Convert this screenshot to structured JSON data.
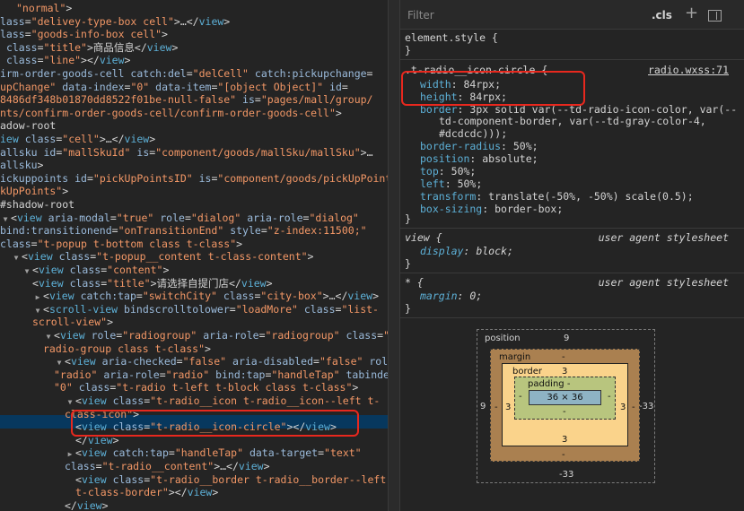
{
  "dom_lines": [
    {
      "segs": [
        [
          "v",
          "\"normal\""
        ],
        [
          "x",
          ">"
        ]
      ]
    },
    {
      "segs": [
        [
          "a",
          "lass"
        ],
        [
          "x",
          "="
        ],
        [
          "v",
          "\"delivey-type-box cell\""
        ],
        [
          "x",
          ">…</"
        ],
        [
          "t",
          "view"
        ],
        [
          "x",
          ">"
        ]
      ]
    },
    {
      "segs": [
        [
          "a",
          "lass"
        ],
        [
          "x",
          "="
        ],
        [
          "v",
          "\"goods-info-box cell\""
        ],
        [
          "x",
          ">"
        ]
      ]
    },
    {
      "segs": [
        [
          "x",
          " "
        ],
        [
          "a",
          "class"
        ],
        [
          "x",
          "="
        ],
        [
          "v",
          "\"title\""
        ],
        [
          "x",
          ">商品信息</"
        ],
        [
          "t",
          "view"
        ],
        [
          "x",
          ">"
        ]
      ]
    },
    {
      "segs": [
        [
          "x",
          " "
        ],
        [
          "a",
          "class"
        ],
        [
          "x",
          "="
        ],
        [
          "v",
          "\"line\""
        ],
        [
          "x",
          "></"
        ],
        [
          "t",
          "view"
        ],
        [
          "x",
          ">"
        ]
      ]
    },
    {
      "segs": [
        [
          "a",
          "irm-order-goods-cell"
        ],
        [
          "x",
          " "
        ],
        [
          "a",
          "catch:del"
        ],
        [
          "x",
          "="
        ],
        [
          "v",
          "\"delCell\""
        ],
        [
          "x",
          " "
        ],
        [
          "a",
          "catch:pickupchange"
        ],
        [
          "x",
          "="
        ]
      ]
    },
    {
      "segs": [
        [
          "v",
          "upChange\""
        ],
        [
          "x",
          " "
        ],
        [
          "a",
          "data-index"
        ],
        [
          "x",
          "="
        ],
        [
          "v",
          "\"0\""
        ],
        [
          "x",
          " "
        ],
        [
          "a",
          "data-item"
        ],
        [
          "x",
          "="
        ],
        [
          "v",
          "\"[object Object]\""
        ],
        [
          "x",
          " "
        ],
        [
          "a",
          "id"
        ],
        [
          "x",
          "="
        ]
      ]
    },
    {
      "segs": [
        [
          "v",
          "8486df348b01870dd8522f01be-null-false\""
        ],
        [
          "x",
          " "
        ],
        [
          "a",
          "is"
        ],
        [
          "x",
          "="
        ],
        [
          "v",
          "\"pages/mall/group/"
        ]
      ]
    },
    {
      "segs": [
        [
          "v",
          "nts/confirm-order-goods-cell/confirm-order-goods-cell\""
        ],
        [
          "x",
          ">"
        ]
      ]
    },
    {
      "segs": [
        [
          "x",
          "adow-root"
        ]
      ]
    },
    {
      "segs": [
        [
          "t",
          "iew"
        ],
        [
          "x",
          " "
        ],
        [
          "a",
          "class"
        ],
        [
          "x",
          "="
        ],
        [
          "v",
          "\"cell\""
        ],
        [
          "x",
          ">…</"
        ],
        [
          "t",
          "view"
        ],
        [
          "x",
          ">"
        ]
      ]
    },
    {
      "segs": [
        [
          "a",
          "allsku"
        ],
        [
          "x",
          " "
        ],
        [
          "a",
          "id"
        ],
        [
          "x",
          "="
        ],
        [
          "v",
          "\"mallSkuId\""
        ],
        [
          "x",
          " "
        ],
        [
          "a",
          "is"
        ],
        [
          "x",
          "="
        ],
        [
          "v",
          "\"component/goods/mallSku/mallSku\""
        ],
        [
          "x",
          ">…"
        ]
      ]
    },
    {
      "segs": [
        [
          "a",
          "allsku"
        ],
        [
          "x",
          ">"
        ]
      ]
    },
    {
      "segs": [
        [
          "a",
          "ickuppoints"
        ],
        [
          "x",
          " "
        ],
        [
          "a",
          "id"
        ],
        [
          "x",
          "="
        ],
        [
          "v",
          "\"pickUpPointsID\""
        ],
        [
          "x",
          " "
        ],
        [
          "a",
          "is"
        ],
        [
          "x",
          "="
        ],
        [
          "v",
          "\"component/goods/pickUpPoints/"
        ]
      ]
    },
    {
      "segs": [
        [
          "v",
          "kUpPoints\""
        ],
        [
          "x",
          ">"
        ]
      ]
    },
    {
      "segs": [
        [
          "x",
          "#shadow-root"
        ]
      ]
    },
    {
      "segs": [
        [
          "tri",
          "▼"
        ],
        [
          "x",
          "<"
        ],
        [
          "t",
          "view"
        ],
        [
          "x",
          " "
        ],
        [
          "a",
          "aria-modal"
        ],
        [
          "x",
          "="
        ],
        [
          "v",
          "\"true\""
        ],
        [
          "x",
          " "
        ],
        [
          "a",
          "role"
        ],
        [
          "x",
          "="
        ],
        [
          "v",
          "\"dialog\""
        ],
        [
          "x",
          " "
        ],
        [
          "a",
          "aria-role"
        ],
        [
          "x",
          "="
        ],
        [
          "v",
          "\"dialog\""
        ]
      ]
    },
    {
      "segs": [
        [
          "a",
          "bind:transitionend"
        ],
        [
          "x",
          "="
        ],
        [
          "v",
          "\"onTransitionEnd\""
        ],
        [
          "x",
          " "
        ],
        [
          "a",
          "style"
        ],
        [
          "x",
          "="
        ],
        [
          "v",
          "\"z-index:11500;\""
        ]
      ]
    },
    {
      "segs": [
        [
          "a",
          "class"
        ],
        [
          "x",
          "="
        ],
        [
          "v",
          "\"t-popup t-bottom class t-class\""
        ],
        [
          "x",
          ">"
        ]
      ]
    },
    {
      "segs": [
        [
          "tri",
          "▼"
        ],
        [
          "x",
          "<"
        ],
        [
          "t",
          "view"
        ],
        [
          "x",
          " "
        ],
        [
          "a",
          "class"
        ],
        [
          "x",
          "="
        ],
        [
          "v",
          "\"t-popup__content t-class-content\""
        ],
        [
          "x",
          ">"
        ]
      ]
    },
    {
      "segs": [
        [
          "tri",
          "▼"
        ],
        [
          "x",
          "<"
        ],
        [
          "t",
          "view"
        ],
        [
          "x",
          " "
        ],
        [
          "a",
          "class"
        ],
        [
          "x",
          "="
        ],
        [
          "v",
          "\"content\""
        ],
        [
          "x",
          ">"
        ]
      ]
    },
    {
      "segs": [
        [
          "x",
          "<"
        ],
        [
          "t",
          "view"
        ],
        [
          "x",
          " "
        ],
        [
          "a",
          "class"
        ],
        [
          "x",
          "="
        ],
        [
          "v",
          "\"title\""
        ],
        [
          "x",
          ">请选择自提门店</"
        ],
        [
          "t",
          "view"
        ],
        [
          "x",
          ">"
        ]
      ]
    },
    {
      "segs": [
        [
          "tri",
          "▶"
        ],
        [
          "x",
          "<"
        ],
        [
          "t",
          "view"
        ],
        [
          "x",
          " "
        ],
        [
          "a",
          "catch:tap"
        ],
        [
          "x",
          "="
        ],
        [
          "v",
          "\"switchCity\""
        ],
        [
          "x",
          " "
        ],
        [
          "a",
          "class"
        ],
        [
          "x",
          "="
        ],
        [
          "v",
          "\"city-box\""
        ],
        [
          "x",
          ">…</"
        ],
        [
          "t",
          "view"
        ],
        [
          "x",
          ">"
        ]
      ]
    },
    {
      "segs": [
        [
          "tri",
          "▼"
        ],
        [
          "x",
          "<"
        ],
        [
          "t",
          "scroll-view"
        ],
        [
          "x",
          " "
        ],
        [
          "a",
          "bindscrolltolower"
        ],
        [
          "x",
          "="
        ],
        [
          "v",
          "\"loadMore\""
        ],
        [
          "x",
          " "
        ],
        [
          "a",
          "class"
        ],
        [
          "x",
          "="
        ],
        [
          "v",
          "\"list-"
        ]
      ]
    },
    {
      "segs": [
        [
          "v",
          "scroll-view\""
        ],
        [
          "x",
          ">"
        ]
      ]
    },
    {
      "segs": [
        [
          "tri",
          "▼"
        ],
        [
          "x",
          "<"
        ],
        [
          "t",
          "view"
        ],
        [
          "x",
          " "
        ],
        [
          "a",
          "role"
        ],
        [
          "x",
          "="
        ],
        [
          "v",
          "\"radiogroup\""
        ],
        [
          "x",
          " "
        ],
        [
          "a",
          "aria-role"
        ],
        [
          "x",
          "="
        ],
        [
          "v",
          "\"radiogroup\""
        ],
        [
          "x",
          " "
        ],
        [
          "a",
          "class"
        ],
        [
          "x",
          "="
        ],
        [
          "v",
          "\"t-"
        ]
      ]
    },
    {
      "segs": [
        [
          "v",
          "radio-group class t-class\""
        ],
        [
          "x",
          ">"
        ]
      ]
    },
    {
      "segs": [
        [
          "tri",
          "▼"
        ],
        [
          "x",
          "<"
        ],
        [
          "t",
          "view"
        ],
        [
          "x",
          " "
        ],
        [
          "a",
          "aria-checked"
        ],
        [
          "x",
          "="
        ],
        [
          "v",
          "\"false\""
        ],
        [
          "x",
          " "
        ],
        [
          "a",
          "aria-disabled"
        ],
        [
          "x",
          "="
        ],
        [
          "v",
          "\"false\""
        ],
        [
          "x",
          " "
        ],
        [
          "a",
          "role"
        ],
        [
          "x",
          "="
        ]
      ]
    },
    {
      "segs": [
        [
          "v",
          "\"radio\""
        ],
        [
          "x",
          " "
        ],
        [
          "a",
          "aria-role"
        ],
        [
          "x",
          "="
        ],
        [
          "v",
          "\"radio\""
        ],
        [
          "x",
          " "
        ],
        [
          "a",
          "bind:tap"
        ],
        [
          "x",
          "="
        ],
        [
          "v",
          "\"handleTap\""
        ],
        [
          "x",
          " "
        ],
        [
          "a",
          "tabindex"
        ],
        [
          "x",
          "="
        ]
      ]
    },
    {
      "segs": [
        [
          "v",
          "\"0\""
        ],
        [
          "x",
          " "
        ],
        [
          "a",
          "class"
        ],
        [
          "x",
          "="
        ],
        [
          "v",
          "\"t-radio t-left t-block class t-class\""
        ],
        [
          "x",
          ">"
        ]
      ]
    },
    {
      "segs": [
        [
          "tri",
          "▼"
        ],
        [
          "x",
          "<"
        ],
        [
          "t",
          "view"
        ],
        [
          "x",
          " "
        ],
        [
          "a",
          "class"
        ],
        [
          "x",
          "="
        ],
        [
          "v",
          "\"t-radio__icon t-radio__icon--left t-"
        ]
      ]
    },
    {
      "segs": [
        [
          "v",
          "class-icon\""
        ],
        [
          "x",
          ">"
        ]
      ]
    },
    {
      "segs": [
        [
          "x",
          "<"
        ],
        [
          "t",
          "view"
        ],
        [
          "x",
          " "
        ],
        [
          "a",
          "class"
        ],
        [
          "x",
          "="
        ],
        [
          "v",
          "\"t-radio__icon-circle\""
        ],
        [
          "x",
          "></"
        ],
        [
          "t",
          "view"
        ],
        [
          "x",
          ">"
        ]
      ]
    },
    {
      "segs": [
        [
          "x",
          "</"
        ],
        [
          "t",
          "view"
        ],
        [
          "x",
          ">"
        ]
      ]
    },
    {
      "segs": [
        [
          "tri",
          "▶"
        ],
        [
          "x",
          "<"
        ],
        [
          "t",
          "view"
        ],
        [
          "x",
          " "
        ],
        [
          "a",
          "catch:tap"
        ],
        [
          "x",
          "="
        ],
        [
          "v",
          "\"handleTap\""
        ],
        [
          "x",
          " "
        ],
        [
          "a",
          "data-target"
        ],
        [
          "x",
          "="
        ],
        [
          "v",
          "\"text\""
        ]
      ]
    },
    {
      "segs": [
        [
          "a",
          "class"
        ],
        [
          "x",
          "="
        ],
        [
          "v",
          "\"t-radio__content\""
        ],
        [
          "x",
          ">…</"
        ],
        [
          "t",
          "view"
        ],
        [
          "x",
          ">"
        ]
      ]
    },
    {
      "segs": [
        [
          "x",
          "<"
        ],
        [
          "t",
          "view"
        ],
        [
          "x",
          " "
        ],
        [
          "a",
          "class"
        ],
        [
          "x",
          "="
        ],
        [
          "v",
          "\"t-radio__border t-radio__border--left"
        ]
      ]
    },
    {
      "segs": [
        [
          "v",
          "t-class-border\""
        ],
        [
          "x",
          "></"
        ],
        [
          "t",
          "view"
        ],
        [
          "x",
          ">"
        ]
      ]
    },
    {
      "segs": [
        [
          "x",
          "</"
        ],
        [
          "t",
          "view"
        ],
        [
          "x",
          ">"
        ]
      ]
    },
    {
      "segs": [
        [
          "x",
          "…"
        ]
      ]
    }
  ],
  "styles": {
    "filter_placeholder": "Filter",
    "cls_label": ".cls",
    "plus_label": "+",
    "element_style": {
      "selector": "element.style {",
      "close": "}"
    },
    "rule1": {
      "selector": ".t-radio__icon-circle {",
      "source": "radio.wxss:71",
      "props": [
        {
          "name": "width",
          "value": "84rpx;"
        },
        {
          "name": "height",
          "value": "84rpx;"
        },
        {
          "name": "border",
          "value": "3px solid var(--td-radio-icon-color, var(--"
        },
        {
          "name": "",
          "value": "td-component-border, var(--td-gray-color-4,"
        },
        {
          "name": "",
          "value": "#dcdcdc)));"
        },
        {
          "name": "border-radius",
          "value": "50%;"
        },
        {
          "name": "position",
          "value": "absolute;"
        },
        {
          "name": "top",
          "value": "50%;"
        },
        {
          "name": "left",
          "value": "50%;"
        },
        {
          "name": "transform",
          "value": "translate(-50%, -50%) scale(0.5);"
        },
        {
          "name": "box-sizing",
          "value": "border-box;"
        }
      ],
      "close": "}"
    },
    "rule2": {
      "selector": "view {",
      "source": "user agent stylesheet",
      "prop_name": "display",
      "prop_value": "block;",
      "close": "}"
    },
    "rule3": {
      "selector": "* {",
      "source": "user agent stylesheet",
      "prop_name": "margin",
      "prop_value": "0;",
      "close": "}"
    }
  },
  "box_model": {
    "position_label": "position",
    "position_top": "9",
    "position_left": "9",
    "position_right": "-33",
    "position_bottom": "-33",
    "margin_label": "margin",
    "margin_top": "-",
    "margin_left": "-",
    "margin_right": "-",
    "margin_bottom": "-",
    "border_label": "border",
    "border_top": "3",
    "border_left": "3",
    "border_right": "3",
    "border_bottom": "3",
    "padding_label": "padding -",
    "padding_left": "-",
    "padding_right": "-",
    "padding_bottom": "-",
    "content": "36 × 36"
  }
}
